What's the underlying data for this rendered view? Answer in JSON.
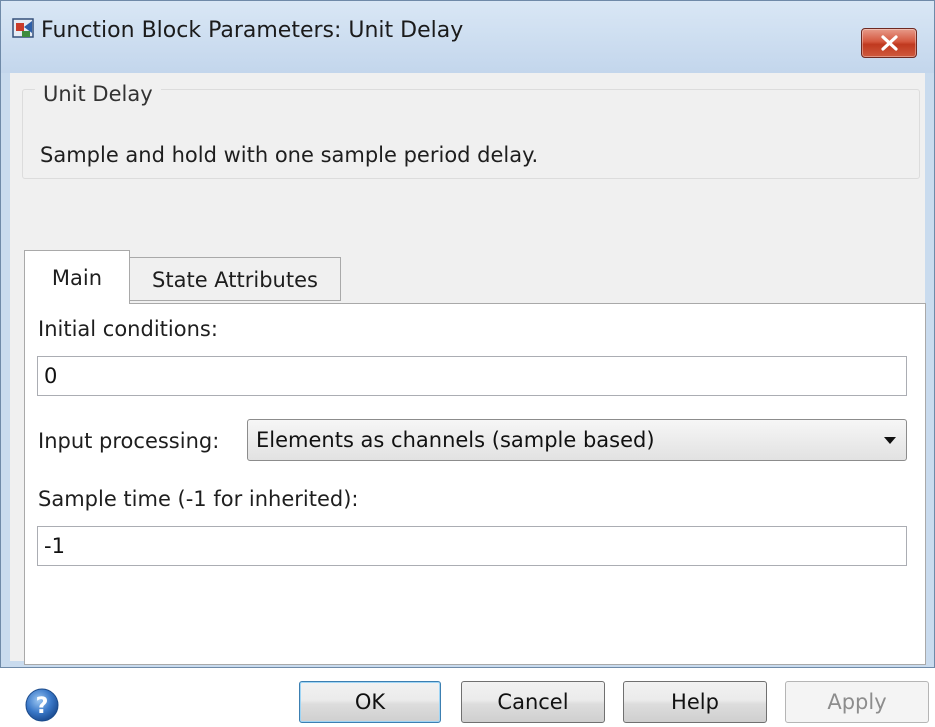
{
  "window": {
    "title": "Function Block Parameters: Unit Delay",
    "close_icon": "close-icon"
  },
  "description": {
    "group_label": "Unit Delay",
    "text": "Sample and hold with one sample period delay."
  },
  "tabs": [
    {
      "label": "Main",
      "selected": true
    },
    {
      "label": "State Attributes",
      "selected": false
    }
  ],
  "main": {
    "initial_conditions_label": "Initial conditions:",
    "initial_conditions_value": "0",
    "input_processing_label": "Input processing:",
    "input_processing_value": "Elements as channels (sample based)",
    "sample_time_label": "Sample time (-1 for inherited):",
    "sample_time_value": "-1"
  },
  "buttons": {
    "ok": "OK",
    "cancel": "Cancel",
    "help": "Help",
    "apply": "Apply",
    "apply_enabled": false
  },
  "colors": {
    "title_bar": "#c9dbee",
    "close_button": "#c8442b",
    "help_icon": "#3a78c8"
  }
}
